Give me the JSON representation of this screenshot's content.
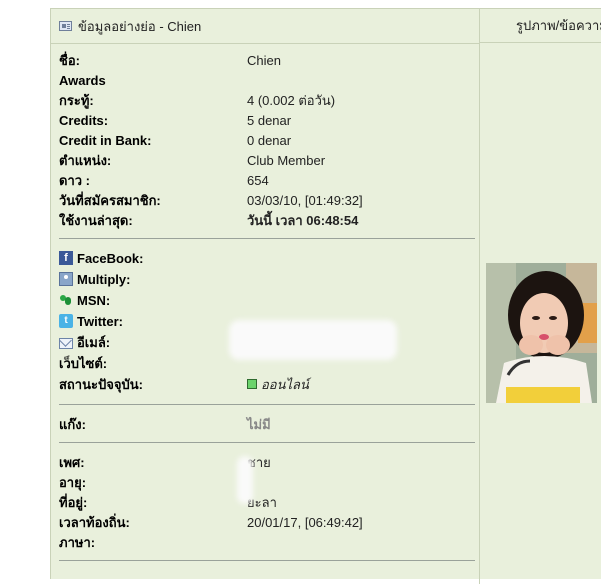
{
  "header": {
    "left_title": "ข้อมูลอย่างย่อ - Chien",
    "right_title": "รูปภาพ/ข้อความ"
  },
  "profile": {
    "rows": [
      {
        "label": "ชื่อ:",
        "value": "Chien"
      },
      {
        "label": "Awards",
        "value": ""
      },
      {
        "label": "กระทู้:",
        "value": "4 (0.002 ต่อวัน)"
      },
      {
        "label": "Credits:",
        "value": "5 denar"
      },
      {
        "label": "Credit in Bank:",
        "value": "0 denar"
      },
      {
        "label": "ตำแหน่ง:",
        "value": "Club Member"
      },
      {
        "label": "ดาว :",
        "value": "654"
      },
      {
        "label": "วันที่สมัครสมาชิก:",
        "value": "03/03/10, [01:49:32]"
      },
      {
        "label": "ใช้งานล่าสุด:",
        "value": "วันนี้ เวลา 06:48:54"
      }
    ]
  },
  "contact": {
    "facebook": "FaceBook:",
    "multiply": "Multiply:",
    "msn": "MSN:",
    "twitter": "Twitter:",
    "email": "อีเมล์:",
    "website": "เว็บไซต์:",
    "status_label": "สถานะปัจจุบัน:",
    "status_value": "ออนไลน์"
  },
  "gang": {
    "label": "แก๊ง:",
    "value": "ไม่มี"
  },
  "details": {
    "gender_label": "เพศ:",
    "gender_value": "ชาย",
    "age_label": "อายุ:",
    "location_label": "ที่อยู่:",
    "location_value": "ยะลา",
    "local_time_label": "เวลาท้องถิ่น:",
    "local_time_value": "20/01/17, [06:49:42]",
    "language_label": "ภาษา:"
  },
  "icons": {
    "header": "profile-card-icon",
    "facebook": "facebook-icon",
    "multiply": "multiply-icon",
    "msn": "msn-icon",
    "twitter": "twitter-icon",
    "email": "email-icon",
    "online": "online-status-icon"
  },
  "colors": {
    "panel_bg": "#e9f0dc",
    "border": "#c9d2b8",
    "separator": "#9aa29a",
    "facebook": "#3b5998",
    "twitter": "#4ab3e6",
    "online": "#6bd36b"
  }
}
